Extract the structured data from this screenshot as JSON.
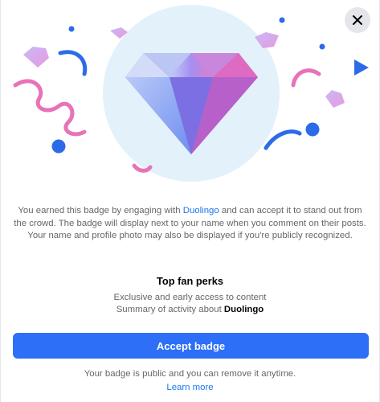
{
  "dialog": {
    "close_icon": "close-icon",
    "hero_icon": "diamond-badge-icon"
  },
  "description": {
    "part1": "You earned this badge by engaging with ",
    "brand": "Duolingo",
    "part2": " and can accept it to stand out from the crowd. The badge will display next to your name when you comment on their posts. Your name and profile photo may also be displayed if you're publicly recognized."
  },
  "perks": {
    "title": "Top fan perks",
    "item1": "Exclusive and early access to content",
    "item2_prefix": "Summary of activity about ",
    "item2_brand": "Duolingo"
  },
  "actions": {
    "accept_label": "Accept badge",
    "public_note": "Your badge is public and you can remove it anytime.",
    "learn_more_label": "Learn more"
  },
  "colors": {
    "accent": "#2d6ff7",
    "link": "#1877f2",
    "confetti_pink": "#e773b8",
    "confetti_blue": "#2c6be8",
    "halo": "#e3f1fa"
  }
}
